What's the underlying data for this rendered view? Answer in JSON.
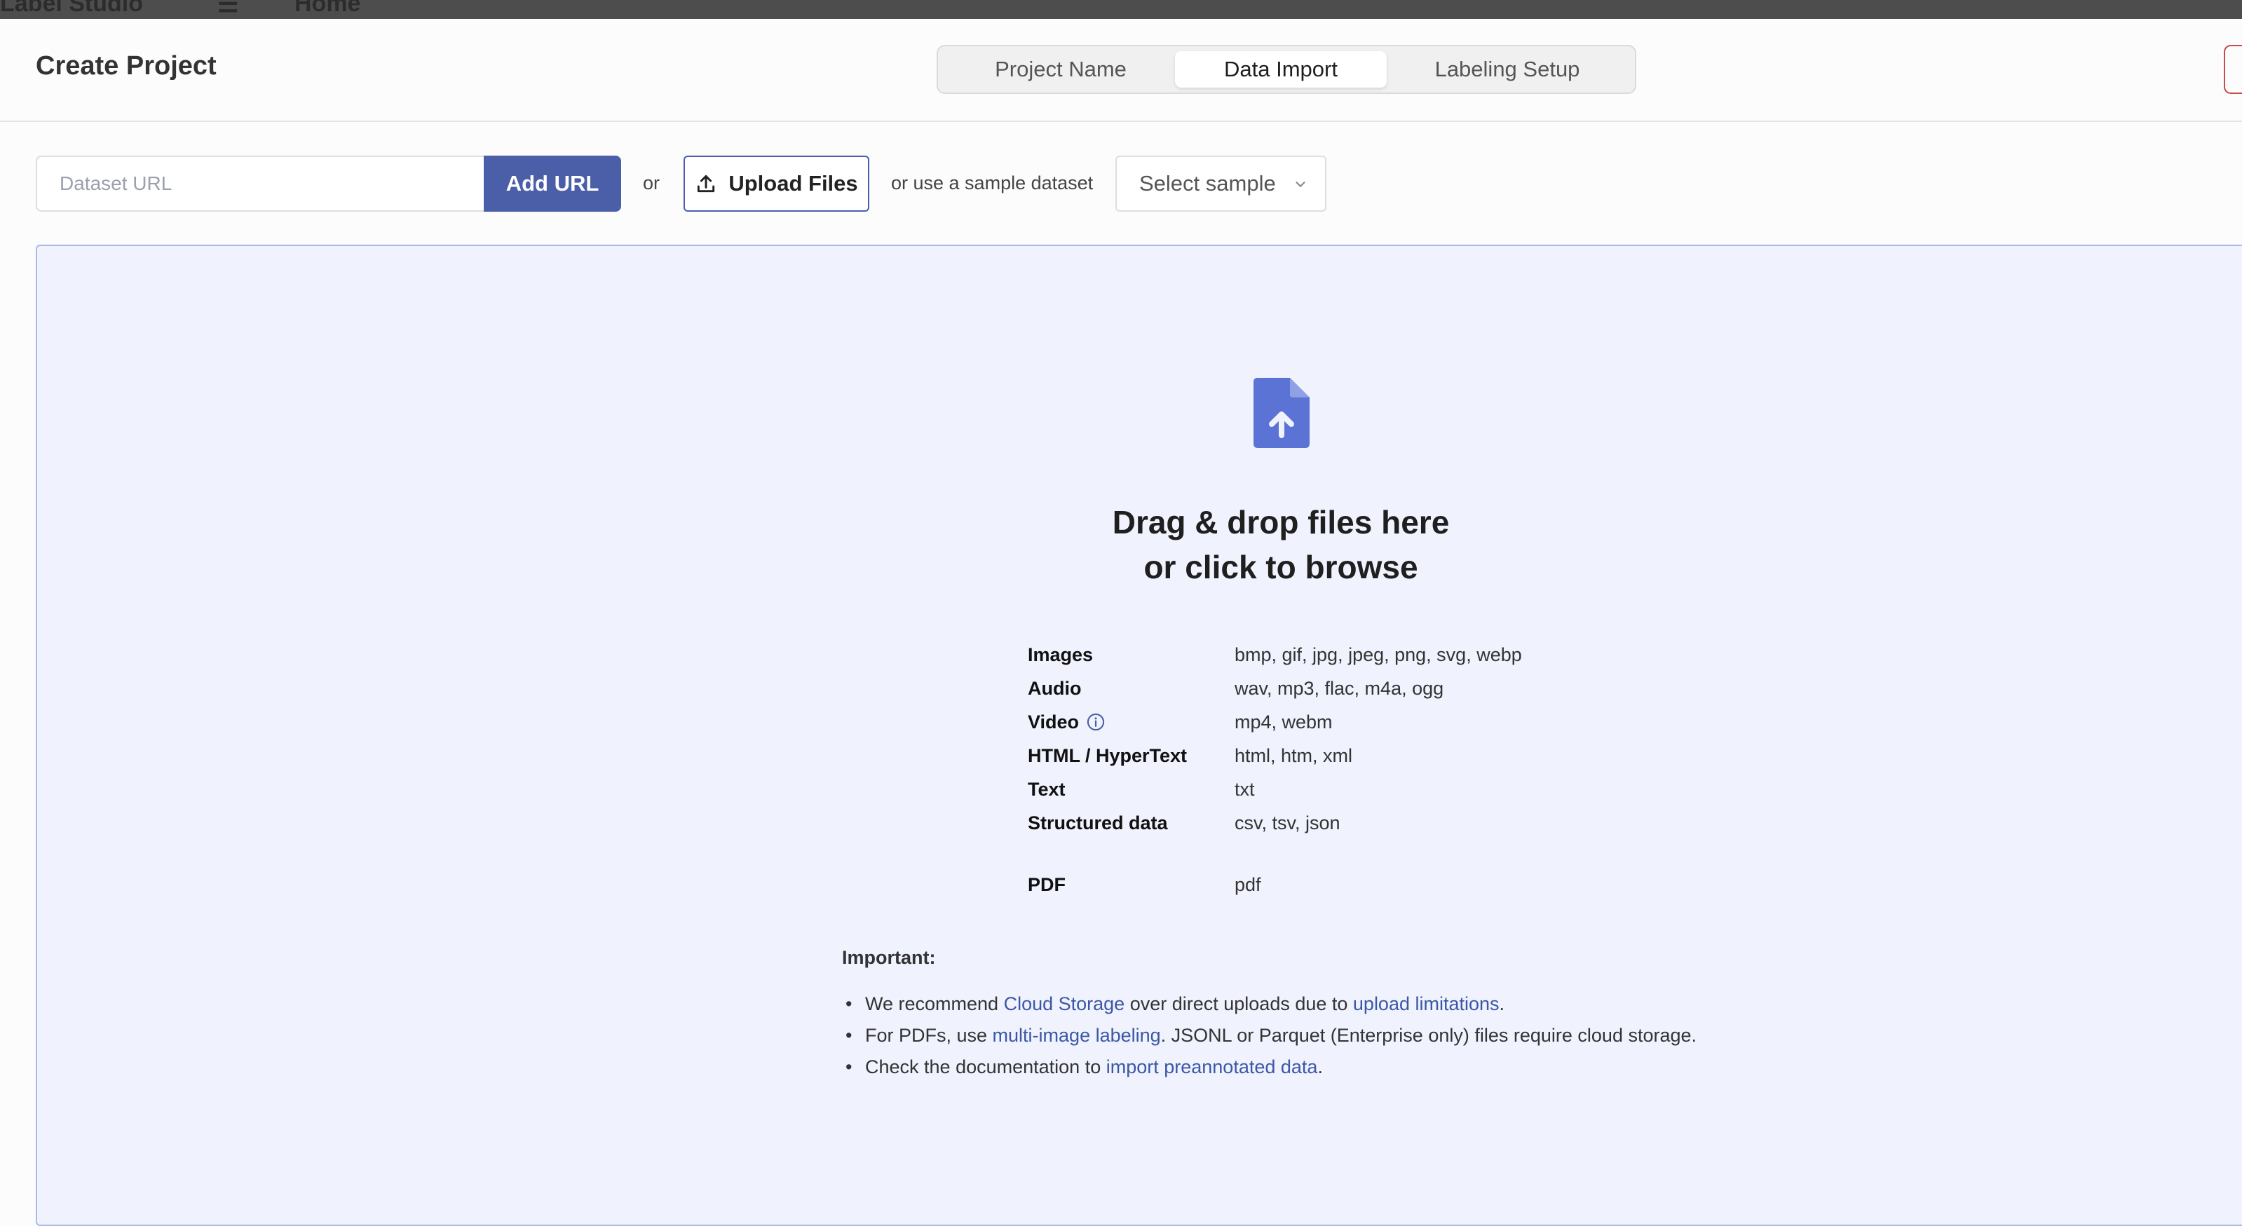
{
  "topbar": {
    "ghost_brand": "Label Studio",
    "ghost_menu": "☰",
    "ghost_home": "Home"
  },
  "header": {
    "title": "Create Project",
    "steps": [
      {
        "label": "Project Name",
        "active": false
      },
      {
        "label": "Data Import",
        "active": true
      },
      {
        "label": "Labeling Setup",
        "active": false
      }
    ]
  },
  "import_bar": {
    "url_placeholder": "Dataset URL",
    "url_value": "",
    "add_url_label": "Add URL",
    "or_label": "or",
    "upload_label": "Upload Files",
    "sample_prompt": "or use a sample dataset",
    "select_label": "Select sample"
  },
  "dropzone": {
    "title_line1": "Drag & drop files here",
    "title_line2": "or click to browse",
    "file_types": [
      {
        "label": "Images",
        "value": "bmp, gif, jpg, jpeg, png, svg, webp"
      },
      {
        "label": "Audio",
        "value": "wav, mp3, flac, m4a, ogg"
      },
      {
        "label": "Video",
        "value": "mp4, webm"
      },
      {
        "label": "HTML / HyperText",
        "value": "html, htm, xml"
      },
      {
        "label": "Text",
        "value": "txt"
      },
      {
        "label": "Structured data",
        "value": "csv, tsv, json"
      },
      {
        "label": "PDF",
        "value": "pdf"
      }
    ],
    "important_label": "Important:",
    "notes": {
      "n1": {
        "a": "We recommend ",
        "link1": "Cloud Storage",
        "b": " over direct uploads due to ",
        "link2": "upload limitations",
        "c": "."
      },
      "n2": {
        "a": "For PDFs, use ",
        "link1": "multi-image labeling",
        "b": ". JSONL or Parquet (Enterprise only) files require cloud storage."
      },
      "n3": {
        "a": "Check the documentation to ",
        "link1": "import preannotated data",
        "b": "."
      }
    }
  },
  "colors": {
    "accent": "#4b5ea8",
    "icon": "#5b73d4",
    "dropzone_bg": "#f0f2fd",
    "link": "#3b57a6"
  },
  "icons": {
    "upload": "upload-icon",
    "file": "file-upload-icon",
    "info": "info-icon",
    "chevron": "chevron-down-icon"
  }
}
